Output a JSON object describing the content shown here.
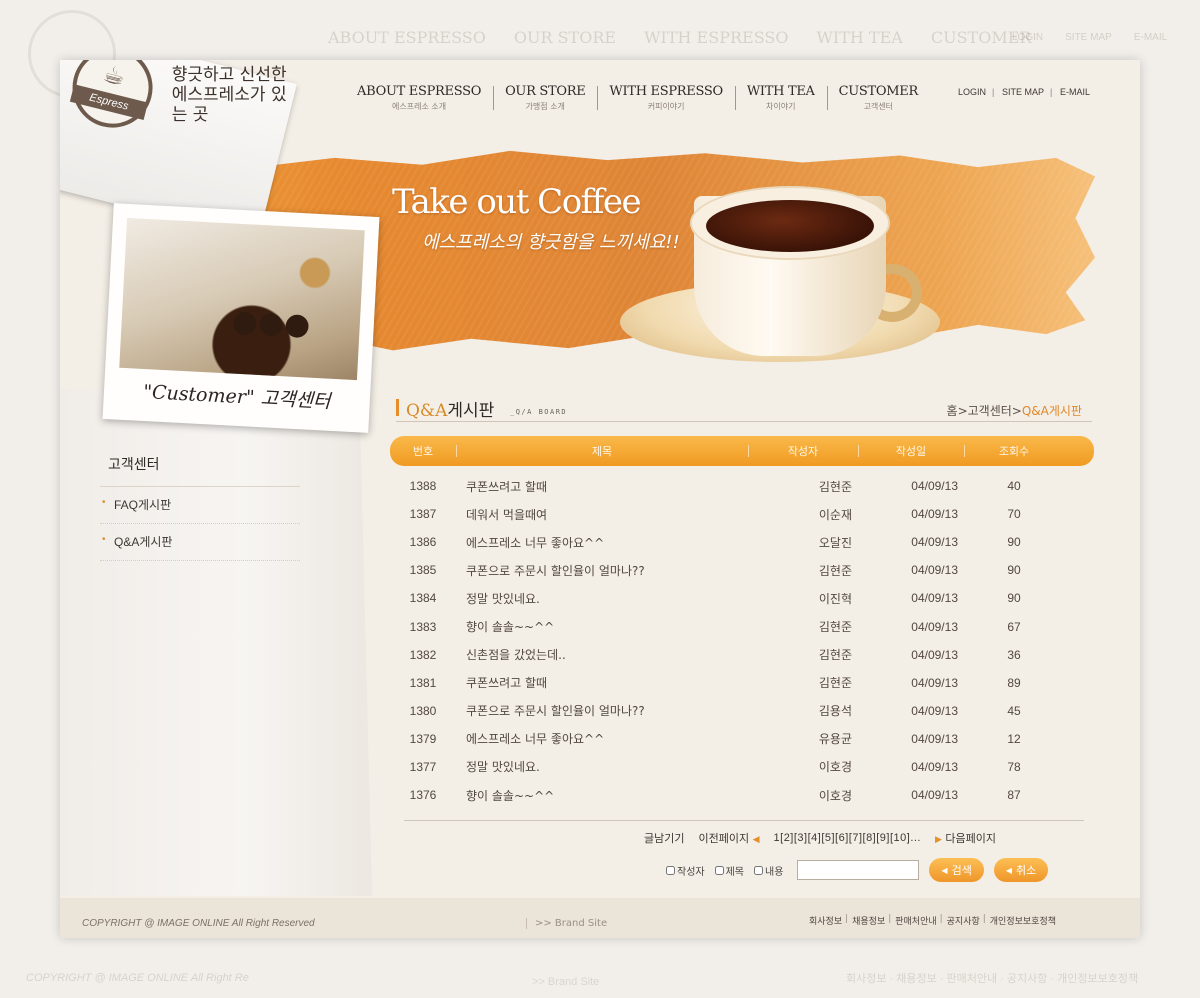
{
  "ghost": {
    "nav": [
      "ABOUT ESPRESSO",
      "OUR STORE",
      "WITH ESPRESSO",
      "WITH TEA",
      "CUSTOMER"
    ],
    "util": [
      "LOGIN",
      "SITE MAP",
      "E-MAIL"
    ],
    "footer": "COPYRIGHT @  IMAGE ONLINE All Right Re",
    "brand": ">> Brand Site",
    "footer_right": "회사정보 · 채용정보 · 판매처안내 · 공지사항 · 개인정보보호정책"
  },
  "logo": {
    "badge": "Espress",
    "tagline": "향긋하고 신선한 에스프레소가 있는 곳"
  },
  "nav": [
    {
      "main": "ABOUT ESPRESSO",
      "sub": "에스프레소 소개"
    },
    {
      "main": "OUR STORE",
      "sub": "가맹점 소개"
    },
    {
      "main": "WITH ESPRESSO",
      "sub": "커피이야기"
    },
    {
      "main": "WITH TEA",
      "sub": "차이야기"
    },
    {
      "main": "CUSTOMER",
      "sub": "고객센터"
    }
  ],
  "util": {
    "login": "LOGIN",
    "sitemap": "SITE MAP",
    "email": "E-MAIL"
  },
  "banner": {
    "title": "Take out Coffee",
    "subtitle": "에스프레소의 향긋함을 느끼세요!!"
  },
  "polaroid": {
    "caption": "\"Customer\" 고객센터"
  },
  "sidebar": {
    "title": "고객센터",
    "items": [
      {
        "label": "FAQ게시판"
      },
      {
        "label": "Q&A게시판"
      }
    ]
  },
  "board": {
    "title_en": "Q&A",
    "title_ko": "게시판",
    "tag": "_Q/A BOARD",
    "breadcrumb": {
      "home": "홈",
      "section": "고객센터",
      "current": "Q&A게시판",
      "sep": ">"
    },
    "columns": [
      "번호",
      "제목",
      "작성자",
      "작성일",
      "조회수"
    ],
    "rows": [
      {
        "no": "1388",
        "title": "쿠폰쓰려고 할때",
        "writer": "김현준",
        "date": "04/09/13",
        "views": "40"
      },
      {
        "no": "1387",
        "title": "데워서 먹을때여",
        "writer": "이순재",
        "date": "04/09/13",
        "views": "70"
      },
      {
        "no": "1386",
        "title": "에스프레소 너무 좋아요^^",
        "writer": "오달진",
        "date": "04/09/13",
        "views": "90"
      },
      {
        "no": "1385",
        "title": "쿠폰으로 주문시 할인율이 얼마나??",
        "writer": "김현준",
        "date": "04/09/13",
        "views": "90"
      },
      {
        "no": "1384",
        "title": "정말 맛있네요.",
        "writer": "이진혁",
        "date": "04/09/13",
        "views": "90"
      },
      {
        "no": "1383",
        "title": "향이 솔솔~~^^",
        "writer": "김현준",
        "date": "04/09/13",
        "views": "67"
      },
      {
        "no": "1382",
        "title": "신촌점을 갔었는데..",
        "writer": "김현준",
        "date": "04/09/13",
        "views": "36"
      },
      {
        "no": "1381",
        "title": "쿠폰쓰려고 할때",
        "writer": "김현준",
        "date": "04/09/13",
        "views": "89"
      },
      {
        "no": "1380",
        "title": "쿠폰으로 주문시 할인율이 얼마나??",
        "writer": "김용석",
        "date": "04/09/13",
        "views": "45"
      },
      {
        "no": "1379",
        "title": "에스프레소 너무 좋아요^^",
        "writer": "유용균",
        "date": "04/09/13",
        "views": "12"
      },
      {
        "no": "1377",
        "title": "정말 맛있네요.",
        "writer": "이호경",
        "date": "04/09/13",
        "views": "78"
      },
      {
        "no": "1376",
        "title": "향이 솔솔~~^^",
        "writer": "이호경",
        "date": "04/09/13",
        "views": "87"
      }
    ]
  },
  "paging": {
    "write": "글남기기",
    "prev": "이전페이지",
    "pages": "1[2][3][4][5][6][7][8][9][10]...",
    "next": "다음페이지"
  },
  "search": {
    "opt_writer": "작성자",
    "opt_title": "제목",
    "opt_content": "내용",
    "search_btn": "검색",
    "cancel_btn": "취소"
  },
  "footer": {
    "copyright": "COPYRIGHT @  IMAGE ONLINE All Right Reserved",
    "brand_site": ">> Brand Site",
    "links": [
      "회사정보",
      "채용정보",
      "판매처안내",
      "공지사항",
      "개인정보보호정책"
    ]
  },
  "colors": {
    "accent": "#f09a22",
    "bg": "#f3eee6",
    "text": "#4a4440"
  }
}
